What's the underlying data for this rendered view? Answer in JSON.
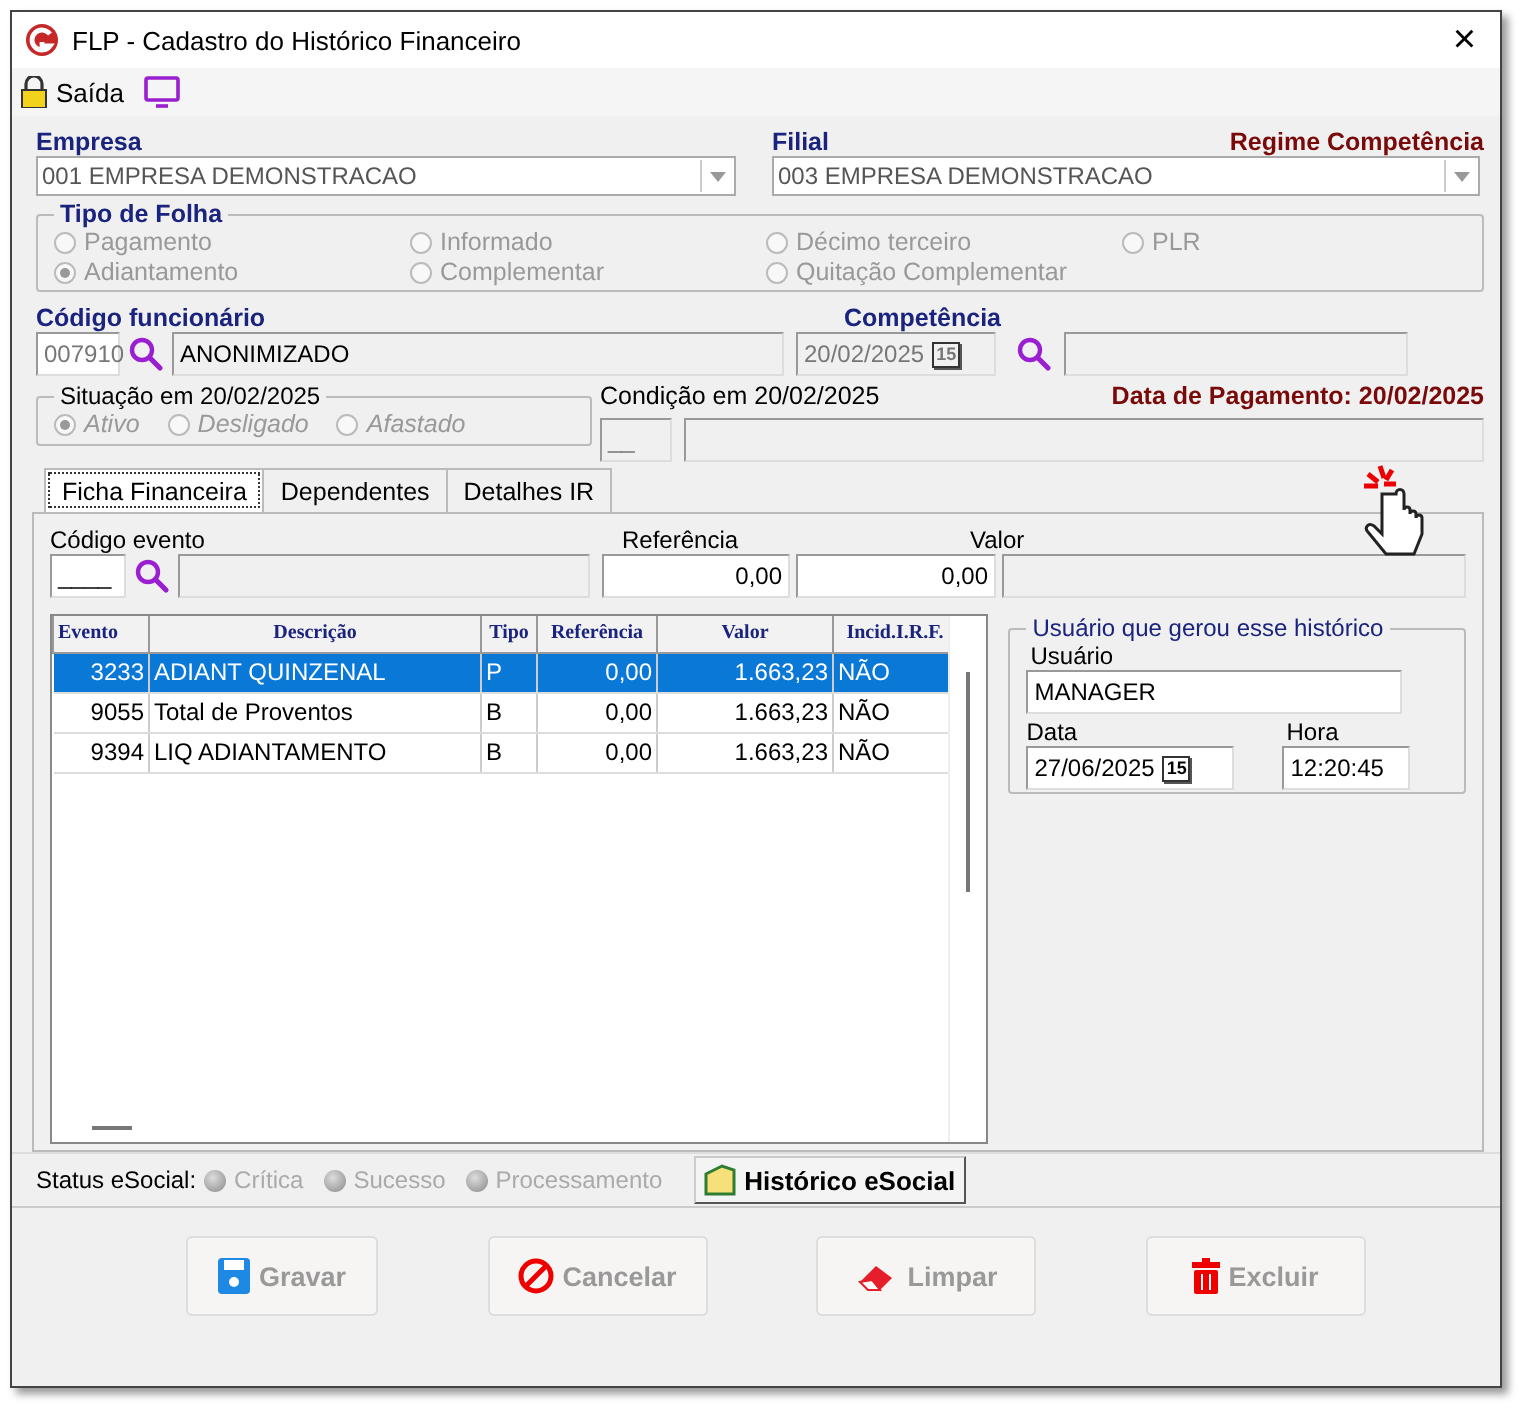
{
  "window": {
    "title": "FLP - Cadastro do Histórico Financeiro",
    "close": "×"
  },
  "toolbar": {
    "exit": "Saída"
  },
  "empresa": {
    "label": "Empresa",
    "value": "001 EMPRESA DEMONSTRACAO"
  },
  "filial": {
    "label": "Filial",
    "value": "003 EMPRESA DEMONSTRACAO"
  },
  "regime": "Regime Competência",
  "tipo_folha": {
    "title": "Tipo de Folha",
    "options": [
      {
        "label": "Pagamento",
        "selected": false
      },
      {
        "label": "Informado",
        "selected": false
      },
      {
        "label": "Décimo terceiro",
        "selected": false
      },
      {
        "label": "PLR",
        "selected": false
      },
      {
        "label": "Adiantamento",
        "selected": true
      },
      {
        "label": "Complementar",
        "selected": false
      },
      {
        "label": "Quitação Complementar",
        "selected": false
      }
    ]
  },
  "funcionario": {
    "label": "Código funcionário",
    "code": "007910",
    "name": "ANONIMIZADO"
  },
  "competencia": {
    "label": "Competência",
    "value": "20/02/2025",
    "calendar": "15"
  },
  "situacao": {
    "title": "Situação em  20/02/2025",
    "options": [
      {
        "label": "Ativo",
        "selected": true
      },
      {
        "label": "Desligado",
        "selected": false
      },
      {
        "label": "Afastado",
        "selected": false
      }
    ]
  },
  "condicao": {
    "label": "Condição em 20/02/2025",
    "code": "__"
  },
  "data_pagamento": "Data de Pagamento: 20/02/2025",
  "tabs": [
    {
      "label": "Ficha Financeira",
      "selected": true
    },
    {
      "label": "Dependentes",
      "selected": false
    },
    {
      "label": "Detalhes IR",
      "selected": false
    }
  ],
  "evento_form": {
    "codigo_label": "Código evento",
    "codigo_value": "____",
    "referencia_label": "Referência",
    "referencia_value": "0,00",
    "valor_label": "Valor",
    "valor_value": "0,00"
  },
  "table": {
    "columns": [
      "Evento",
      "Descrição",
      "Tipo",
      "Referência",
      "Valor",
      "Incid.I.R.F."
    ],
    "rows": [
      {
        "cells": [
          "3233",
          "ADIANT QUINZENAL",
          "P",
          "0,00",
          "1.663,23",
          "NÃO"
        ],
        "selected": true
      },
      {
        "cells": [
          "9055",
          "Total de Proventos",
          "B",
          "0,00",
          "1.663,23",
          "NÃO"
        ],
        "selected": false
      },
      {
        "cells": [
          "9394",
          "LIQ ADIANTAMENTO",
          "B",
          "0,00",
          "1.663,23",
          "NÃO"
        ],
        "selected": false
      }
    ]
  },
  "usuario_group": {
    "title": "Usuário que gerou esse histórico",
    "usuario_label": "Usuário",
    "usuario": "MANAGER",
    "data_label": "Data",
    "data": "27/06/2025",
    "calendar": "15",
    "hora_label": "Hora",
    "hora": "12:20:45"
  },
  "status_esocial": {
    "label": "Status eSocial:",
    "items": [
      "Crítica",
      "Sucesso",
      "Processamento"
    ],
    "button": "Histórico eSocial"
  },
  "buttons": [
    {
      "kind": "save",
      "label": "Gravar"
    },
    {
      "kind": "cancel",
      "label": "Cancelar"
    },
    {
      "kind": "clear",
      "label": "Limpar"
    },
    {
      "kind": "delete",
      "label": "Excluir"
    }
  ]
}
